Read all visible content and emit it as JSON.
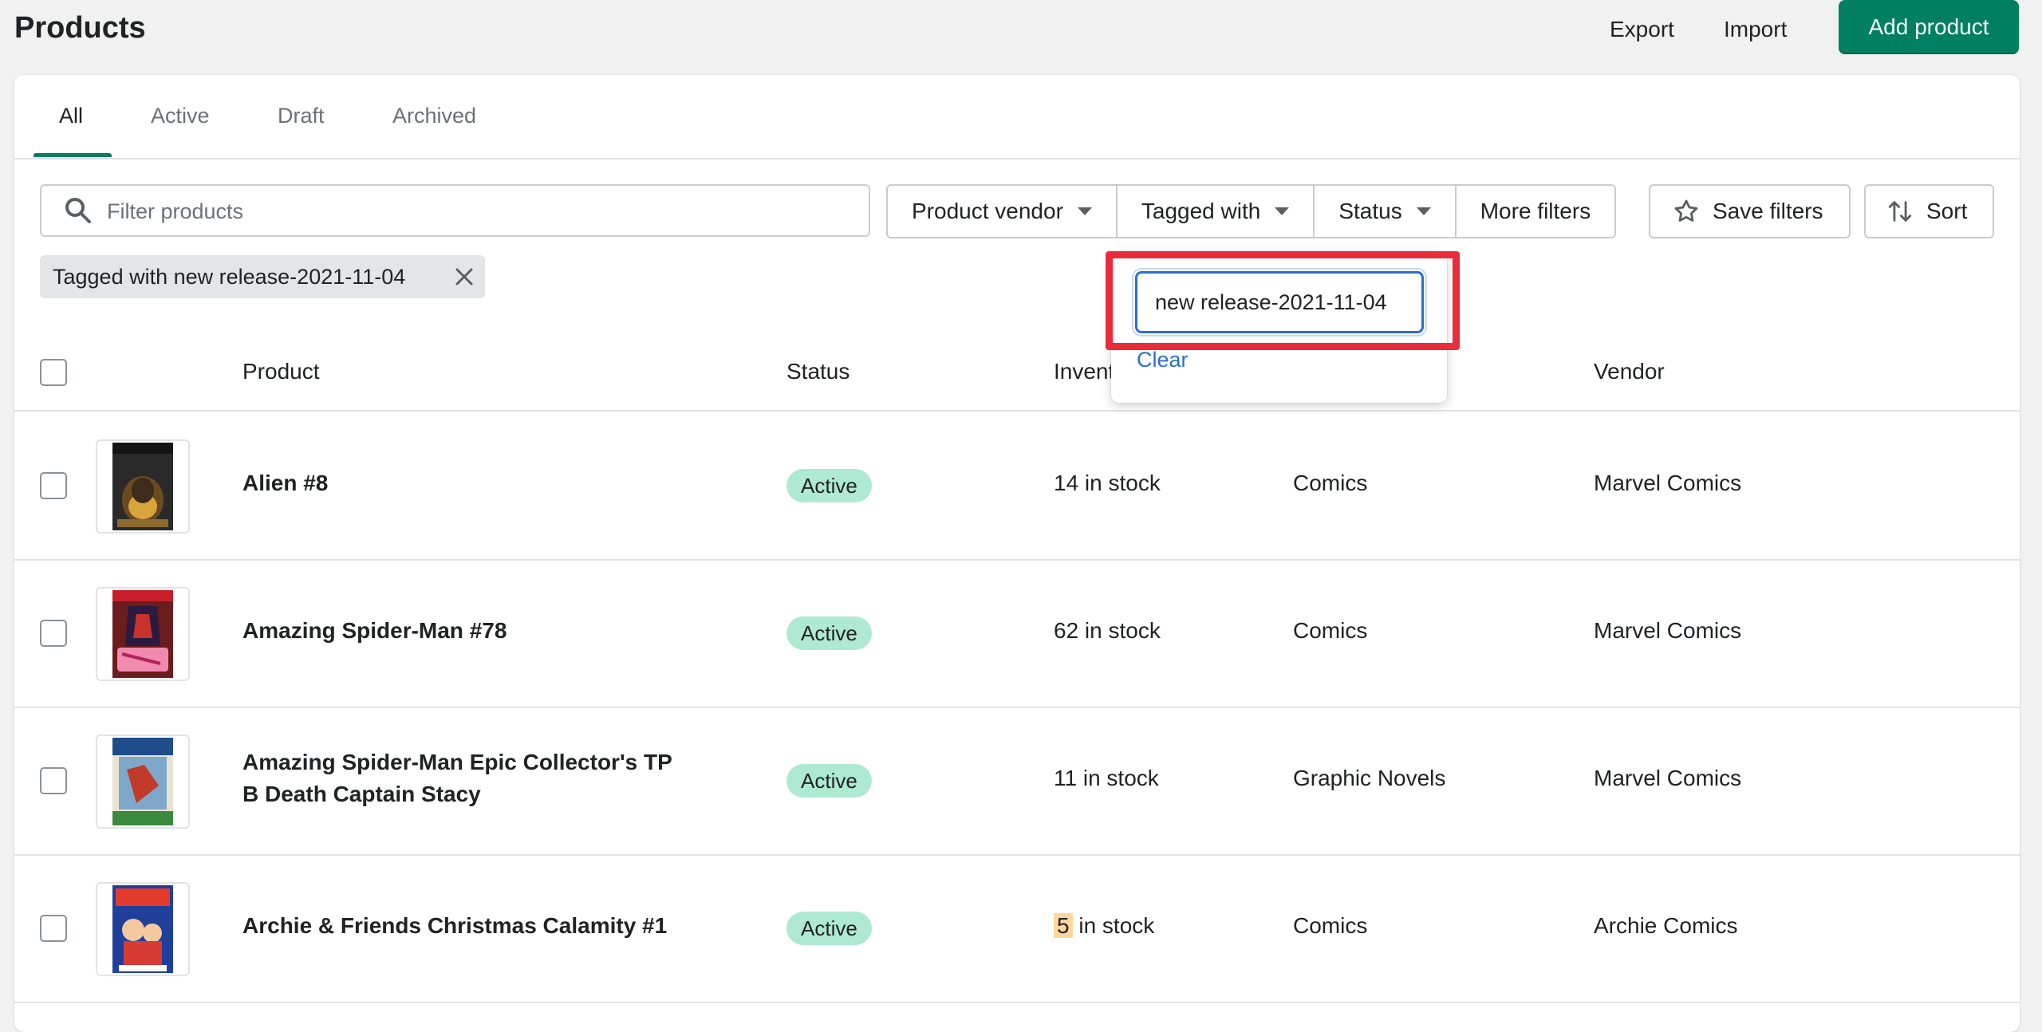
{
  "header": {
    "title": "Products",
    "export_label": "Export",
    "import_label": "Import",
    "add_label": "Add product"
  },
  "tabs": [
    {
      "label": "All",
      "active": true
    },
    {
      "label": "Active"
    },
    {
      "label": "Draft"
    },
    {
      "label": "Archived"
    }
  ],
  "search": {
    "placeholder": "Filter products",
    "value": ""
  },
  "filters": {
    "vendor_label": "Product vendor",
    "tagged_label": "Tagged with",
    "status_label": "Status",
    "more_label": "More filters",
    "save_label": "Save filters",
    "sort_label": "Sort"
  },
  "applied_filter": {
    "label": "Tagged with new release-2021-11-04"
  },
  "tag_popover": {
    "input_value": "new release-2021-11-04",
    "clear_label": "Clear"
  },
  "table": {
    "headers": {
      "product": "Product",
      "status": "Status",
      "inventory": "Invent",
      "vendor": "Vendor"
    },
    "rows": [
      {
        "name": "Alien #8",
        "name_line2": "",
        "status": "Active",
        "stock_count": "14",
        "stock_suffix": " in stock",
        "type": "Comics",
        "vendor": "Marvel Comics"
      },
      {
        "name": "Amazing Spider-Man #78",
        "name_line2": "",
        "status": "Active",
        "stock_count": "62",
        "stock_suffix": " in stock",
        "type": "Comics",
        "vendor": "Marvel Comics"
      },
      {
        "name": "Amazing Spider-Man Epic Collector's TP",
        "name_line2": "B Death Captain Stacy",
        "status": "Active",
        "stock_count": "11",
        "stock_suffix": " in stock",
        "type": "Graphic Novels",
        "vendor": "Marvel Comics"
      },
      {
        "name": "Archie & Friends Christmas Calamity #1",
        "name_line2": "",
        "status": "Active",
        "stock_count": "5",
        "stock_suffix": " in stock",
        "type": "Comics",
        "vendor": "Archie Comics"
      }
    ]
  },
  "colors": {
    "primary": "#008060",
    "active_badge": "#aee9d1",
    "low_stock": "#ffd79d",
    "highlight": "#ea2b3a",
    "link": "#2c6ecb"
  }
}
